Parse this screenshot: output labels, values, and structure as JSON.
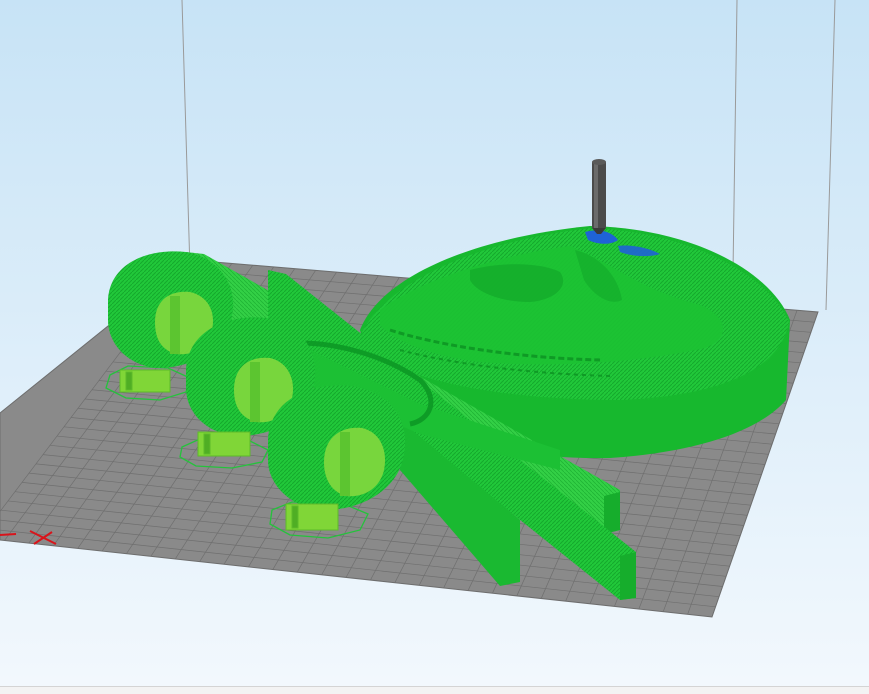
{
  "viewport": {
    "kind": "3d-print-preview",
    "background_color": "#c7e3f6",
    "build_plate_color": "#8a8a8a",
    "grid_line_color": "#6f6f6f",
    "print_color": "#21c83a",
    "support_color": "#80d637",
    "overhang_color": "#1f63d6",
    "nozzle_color": "#4b4b4b",
    "origin_marker_color": "#d8141b"
  }
}
